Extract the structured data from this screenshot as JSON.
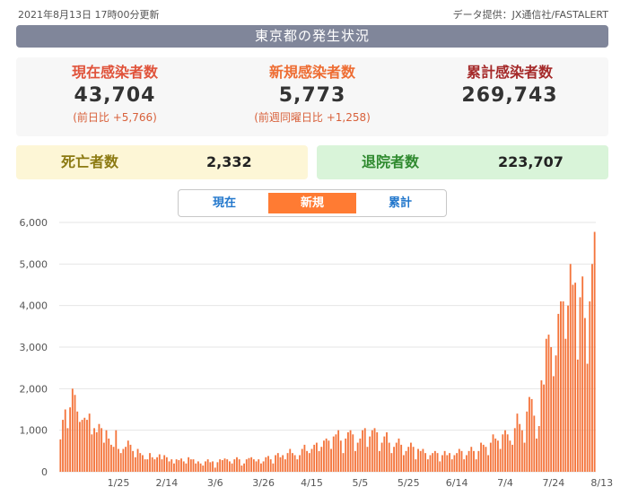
{
  "header": {
    "updated": "2021年8月13日 17時00分更新",
    "source": "データ提供：JX通信社/FASTALERT",
    "region_title": "東京都の発生状況"
  },
  "stats": {
    "current": {
      "label": "現在感染者数",
      "value": "43,704",
      "diff": "(前日比 +5,766)"
    },
    "new": {
      "label": "新規感染者数",
      "value": "5,773",
      "diff": "(前週同曜日比 +1,258)"
    },
    "total": {
      "label": "累計感染者数",
      "value": "269,743"
    }
  },
  "deaths": {
    "label": "死亡者数",
    "value": "2,332"
  },
  "recovered": {
    "label": "退院者数",
    "value": "223,707"
  },
  "tabs": [
    {
      "label": "現在",
      "selected": false
    },
    {
      "label": "新規",
      "selected": true
    },
    {
      "label": "累計",
      "selected": false
    }
  ],
  "colors": {
    "bar": "#f4743b",
    "accent": "#ff7b33",
    "tab_text": "#2277cc",
    "grid": "#e6e6e6"
  },
  "chart_data": {
    "type": "bar",
    "title": "",
    "xlabel": "",
    "ylabel": "",
    "ylim": [
      0,
      6000
    ],
    "yticks": [
      0,
      1000,
      2000,
      3000,
      4000,
      5000,
      6000
    ],
    "ytick_labels": [
      "0",
      "1,000",
      "2,000",
      "3,000",
      "4,000",
      "5,000",
      "6,000"
    ],
    "xtick_labels": [
      {
        "label": "1/25",
        "index": 24
      },
      {
        "label": "2/14",
        "index": 44
      },
      {
        "label": "3/6",
        "index": 64
      },
      {
        "label": "3/26",
        "index": 84
      },
      {
        "label": "4/15",
        "index": 104
      },
      {
        "label": "5/5",
        "index": 124
      },
      {
        "label": "5/25",
        "index": 144
      },
      {
        "label": "6/14",
        "index": 164
      },
      {
        "label": "7/4",
        "index": 184
      },
      {
        "label": "7/24",
        "index": 204
      },
      {
        "label": "8/13",
        "index": 224
      }
    ],
    "x_start": "2021-01-01",
    "x_end": "2021-08-13",
    "series": [
      {
        "values": [
          780,
          1250,
          1500,
          1050,
          1550,
          2000,
          1850,
          1450,
          1200,
          1250,
          1300,
          1250,
          1400,
          900,
          1050,
          950,
          1150,
          1050,
          700,
          1000,
          800,
          650,
          600,
          1000,
          550,
          450,
          550,
          600,
          750,
          650,
          500,
          350,
          550,
          450,
          400,
          300,
          300,
          450,
          350,
          300,
          350,
          420,
          300,
          400,
          350,
          250,
          300,
          200,
          300,
          280,
          320,
          250,
          200,
          350,
          300,
          300,
          200,
          250,
          200,
          150,
          250,
          300,
          230,
          250,
          100,
          230,
          300,
          280,
          320,
          300,
          250,
          200,
          300,
          350,
          300,
          150,
          200,
          300,
          330,
          350,
          300,
          250,
          300,
          200,
          250,
          350,
          380,
          300,
          200,
          400,
          450,
          350,
          400,
          300,
          450,
          550,
          450,
          400,
          300,
          400,
          550,
          650,
          500,
          450,
          550,
          650,
          700,
          500,
          600,
          750,
          800,
          750,
          550,
          850,
          900,
          1000,
          750,
          450,
          800,
          950,
          1000,
          900,
          500,
          700,
          800,
          1000,
          1050,
          600,
          850,
          1000,
          1050,
          950,
          500,
          700,
          850,
          950,
          700,
          450,
          600,
          700,
          800,
          650,
          400,
          500,
          600,
          700,
          600,
          300,
          550,
          500,
          550,
          450,
          300,
          400,
          450,
          500,
          450,
          250,
          400,
          500,
          400,
          450,
          300,
          400,
          450,
          550,
          500,
          300,
          400,
          500,
          600,
          500,
          300,
          500,
          700,
          650,
          600,
          400,
          700,
          900,
          800,
          750,
          550,
          900,
          1000,
          900,
          750,
          650,
          1050,
          1400,
          1150,
          1000,
          700,
          1450,
          1800,
          1750,
          1350,
          800,
          1100,
          2200,
          2100,
          3200,
          3300,
          3000,
          2300,
          2800,
          3800,
          4100,
          4100,
          3200,
          4000,
          5000,
          4500,
          4550,
          2700,
          4200,
          4700,
          3700,
          2600,
          4100,
          5000,
          5773
        ]
      }
    ]
  }
}
